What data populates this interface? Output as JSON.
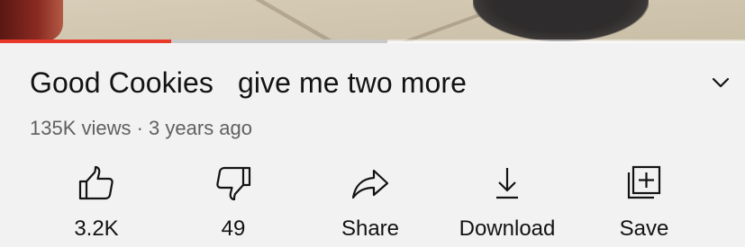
{
  "player": {
    "played_fraction": 0.23,
    "loaded_fraction": 0.52
  },
  "video": {
    "title": "Good Cookies   give me two more",
    "meta": "135K views · 3 years ago"
  },
  "actions": {
    "like_count": "3.2K",
    "dislike_count": "49",
    "share_label": "Share",
    "download_label": "Download",
    "save_label": "Save"
  },
  "icons": {
    "like": "thumbs-up-icon",
    "dislike": "thumbs-down-icon",
    "share": "share-arrow-icon",
    "download": "download-icon",
    "save": "playlist-add-icon",
    "expand": "chevron-down-icon"
  },
  "colors": {
    "progress_played": "#e8392b",
    "text_primary": "#131313",
    "text_secondary": "#606060",
    "background": "#f2f2f2"
  }
}
